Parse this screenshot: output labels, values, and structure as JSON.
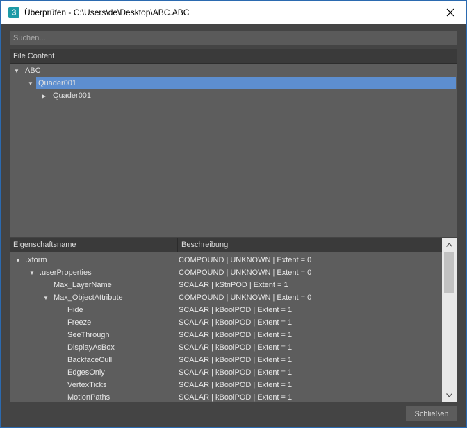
{
  "window": {
    "app_icon": "3",
    "title": "Überprüfen - C:\\Users\\de\\Desktop\\ABC.ABC"
  },
  "search": {
    "placeholder": "Suchen..."
  },
  "file_panel": {
    "header": "File Content",
    "tree": [
      {
        "label": "ABC",
        "level": 0,
        "expanded": true
      },
      {
        "label": "Quader001",
        "level": 1,
        "expanded": true,
        "selected": true
      },
      {
        "label": "Quader001",
        "level": 2,
        "expanded": false
      }
    ]
  },
  "property_panel": {
    "col_name": "Eigenschaftsname",
    "col_desc": "Beschreibung",
    "rows": [
      {
        "name": ".xform",
        "desc": "COMPOUND | UNKNOWN | Extent = 0",
        "level": 0,
        "expander": "expanded"
      },
      {
        "name": ".userProperties",
        "desc": "COMPOUND | UNKNOWN | Extent = 0",
        "level": 1,
        "expander": "expanded"
      },
      {
        "name": "Max_LayerName",
        "desc": "SCALAR | kStriPOD | Extent = 1",
        "level": 2,
        "expander": "none"
      },
      {
        "name": "Max_ObjectAttribute",
        "desc": "COMPOUND | UNKNOWN | Extent = 0",
        "level": 2,
        "expander": "expanded"
      },
      {
        "name": "Hide",
        "desc": "SCALAR | kBoolPOD | Extent = 1",
        "level": 3,
        "expander": "none"
      },
      {
        "name": "Freeze",
        "desc": "SCALAR | kBoolPOD | Extent = 1",
        "level": 3,
        "expander": "none"
      },
      {
        "name": "SeeThrough",
        "desc": "SCALAR | kBoolPOD | Extent = 1",
        "level": 3,
        "expander": "none"
      },
      {
        "name": "DisplayAsBox",
        "desc": "SCALAR | kBoolPOD | Extent = 1",
        "level": 3,
        "expander": "none"
      },
      {
        "name": "BackfaceCull",
        "desc": "SCALAR | kBoolPOD | Extent = 1",
        "level": 3,
        "expander": "none"
      },
      {
        "name": "EdgesOnly",
        "desc": "SCALAR | kBoolPOD | Extent = 1",
        "level": 3,
        "expander": "none"
      },
      {
        "name": "VertexTicks",
        "desc": "SCALAR | kBoolPOD | Extent = 1",
        "level": 3,
        "expander": "none"
      },
      {
        "name": "MotionPaths",
        "desc": "SCALAR | kBoolPOD | Extent = 1",
        "level": 3,
        "expander": "none"
      }
    ]
  },
  "footer": {
    "close_label": "Schließen"
  },
  "colors": {
    "background": "#444444",
    "panel": "#5d5d5d",
    "header": "#3a3a3a",
    "selection": "#5d8ecf",
    "title_border": "#2b6ab0"
  },
  "icons": {
    "app": "3ds-max-icon",
    "close": "close-icon",
    "expanded": "triangle-down-icon",
    "collapsed": "triangle-right-icon",
    "scroll_up": "chevron-up-icon",
    "scroll_down": "chevron-down-icon"
  }
}
